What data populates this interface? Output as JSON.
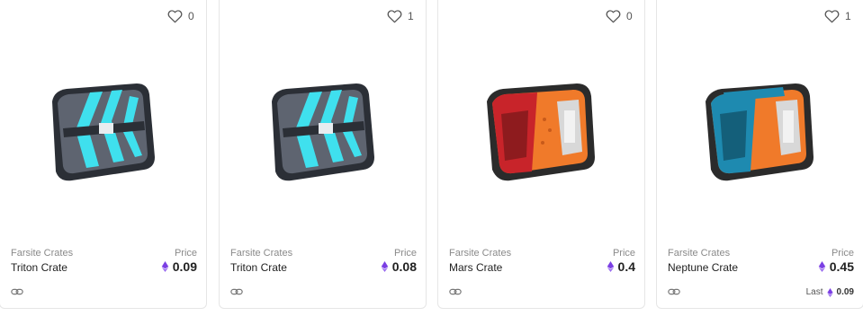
{
  "cards": [
    {
      "likes": "0",
      "collection": "Farsite Crates",
      "name": "Triton Crate",
      "price_label": "Price",
      "price": "0.09",
      "image": "triton-crate",
      "colors": {
        "body": "#5e6470",
        "accent": "#3fe0ee",
        "dark": "#2b2f36"
      }
    },
    {
      "likes": "1",
      "collection": "Farsite Crates",
      "name": "Triton Crate",
      "price_label": "Price",
      "price": "0.08",
      "image": "triton-crate",
      "colors": {
        "body": "#5e6470",
        "accent": "#3fe0ee",
        "dark": "#2b2f36"
      }
    },
    {
      "likes": "0",
      "collection": "Farsite Crates",
      "name": "Mars Crate",
      "price_label": "Price",
      "price": "0.4",
      "image": "mars-crate",
      "colors": {
        "body": "#f07a2a",
        "accent": "#c8242a",
        "dark": "#2b2b2b"
      }
    },
    {
      "likes": "1",
      "collection": "Farsite Crates",
      "name": "Neptune Crate",
      "price_label": "Price",
      "price": "0.45",
      "image": "neptune-crate",
      "colors": {
        "body": "#f07a2a",
        "accent": "#1e8ab0",
        "dark": "#2b2b2b"
      },
      "last_label": "Last",
      "last_price": "0.09"
    }
  ],
  "icons": {
    "like": "heart-icon",
    "currency": "ethereum-icon",
    "link": "chain-link-icon"
  },
  "theme": {
    "eth_color": "#7b3fe4",
    "muted": "#8a8a8a"
  }
}
